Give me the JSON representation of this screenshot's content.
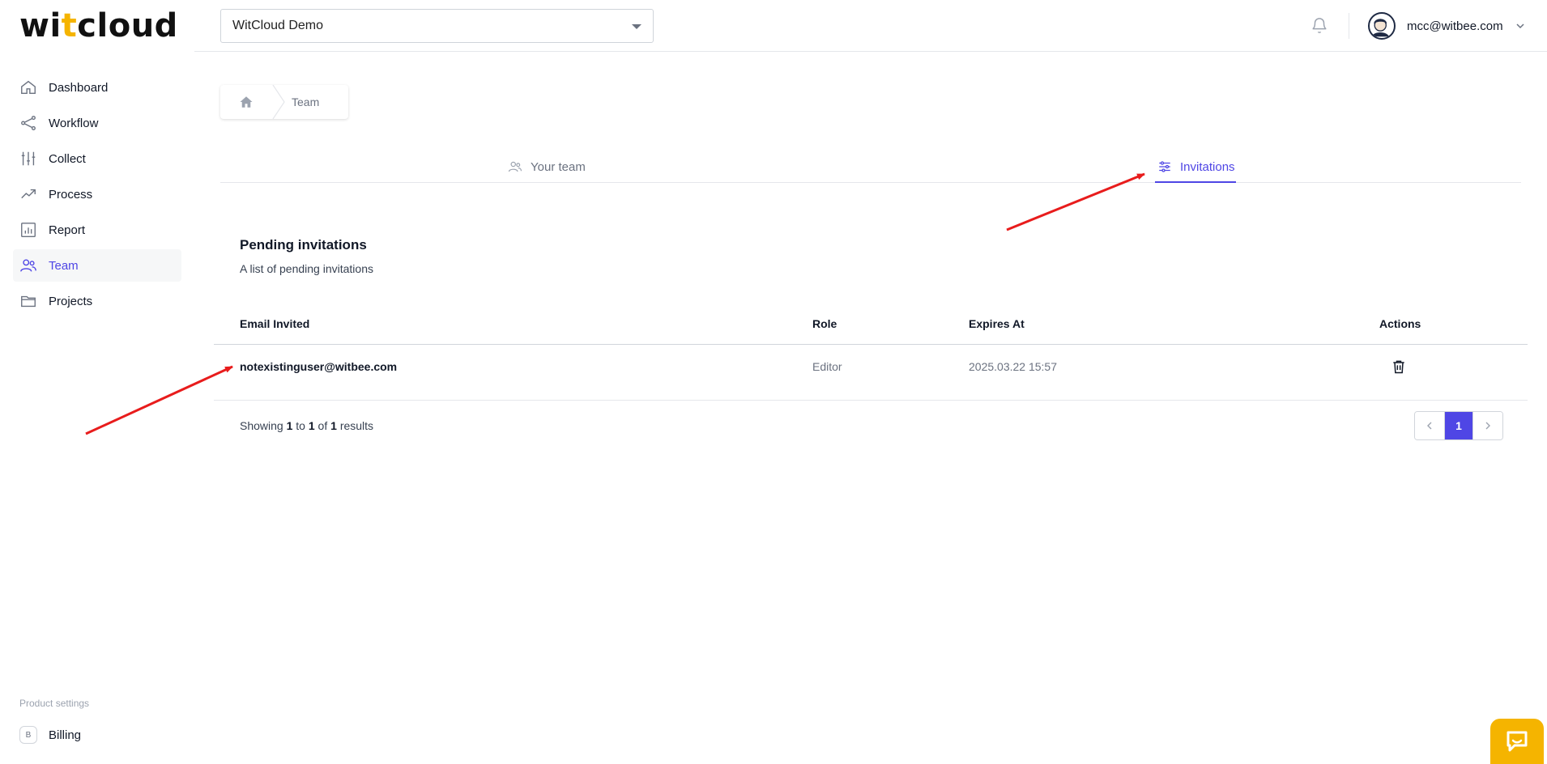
{
  "logo": {
    "part1": "wi",
    "part2": "t",
    "part3": "cloud"
  },
  "header": {
    "project_selected": "WitCloud Demo",
    "user_email": "mcc@witbee.com"
  },
  "sidebar": {
    "items": [
      {
        "label": "Dashboard",
        "icon": "home-icon"
      },
      {
        "label": "Workflow",
        "icon": "share-icon"
      },
      {
        "label": "Collect",
        "icon": "sliders-icon"
      },
      {
        "label": "Process",
        "icon": "trending-up-icon"
      },
      {
        "label": "Report",
        "icon": "bar-chart-icon"
      },
      {
        "label": "Team",
        "icon": "users-icon",
        "active": true
      },
      {
        "label": "Projects",
        "icon": "folder-icon"
      }
    ],
    "product_settings_label": "Product settings",
    "billing_badge": "B",
    "billing_label": "Billing"
  },
  "breadcrumb": {
    "current": "Team"
  },
  "tabs": [
    {
      "label": "Your team",
      "icon": "users-icon"
    },
    {
      "label": "Invitations",
      "icon": "adjustments-icon",
      "active": true
    }
  ],
  "section": {
    "title": "Pending invitations",
    "subtitle": "A list of pending invitations"
  },
  "table": {
    "columns": [
      "Email Invited",
      "Role",
      "Expires At",
      "Actions"
    ],
    "rows": [
      {
        "email": "notexistinguser@witbee.com",
        "role": "Editor",
        "expires": "2025.03.22 15:57",
        "action_icon": "trash-icon"
      }
    ]
  },
  "results": {
    "prefix": "Showing",
    "from": "1",
    "to_word": "to",
    "to": "1",
    "of_word": "of",
    "total": "1",
    "suffix": "results"
  },
  "pagination": {
    "current_page": "1"
  },
  "colors": {
    "accent": "#4f46e5",
    "brand_yellow": "#f5b400",
    "annotation_red": "#e81c1c"
  }
}
